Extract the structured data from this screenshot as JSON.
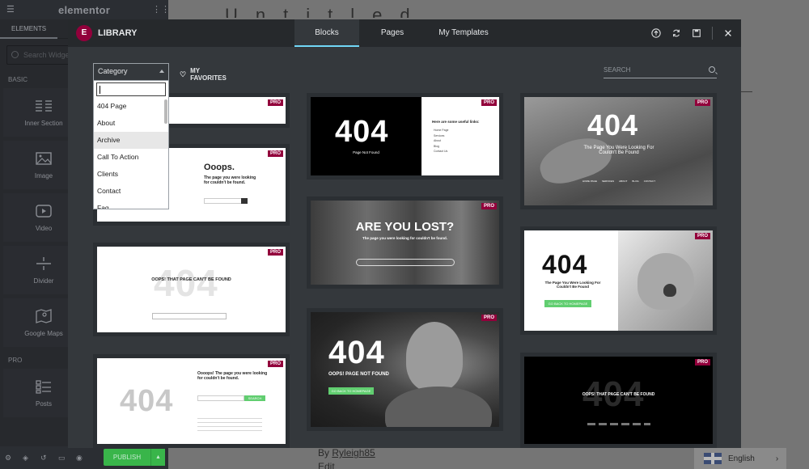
{
  "sidebar": {
    "brand": "elementor",
    "tab": "ELEMENTS",
    "search_placeholder": "Search Widget",
    "category_basic": "BASIC",
    "category_pro": "PRO",
    "widgets": [
      "Inner Section",
      "Image",
      "Video",
      "Divider",
      "Google Maps",
      "Posts"
    ],
    "publish_label": "PUBLISH"
  },
  "preview": {
    "title_stub": "Untitled",
    "by_label": "By",
    "author": "Ryleigh85",
    "edit_label": "Edit",
    "language": "English"
  },
  "modal": {
    "title": "LIBRARY",
    "tabs": [
      "Blocks",
      "Pages",
      "My Templates"
    ],
    "active_tab": "Blocks",
    "category_label": "Category",
    "category_options": [
      "404 Page",
      "About",
      "Archive",
      "Call To Action",
      "Clients",
      "Contact",
      "Faq"
    ],
    "highlighted_option": "Archive",
    "favorites_label": "MY FAVORITES",
    "search_placeholder": "SEARCH",
    "pro_badge": "PRO",
    "accent_color": "#92003b",
    "tab_underline_color": "#71d7f7"
  },
  "templates": {
    "c2": {
      "heading": "Ooops.",
      "sub": "The page you were looking for couldn't be found."
    },
    "c3": {
      "text": "OOPS! THAT PAGE CAN'T BE FOUND"
    },
    "c4": {
      "number": "404",
      "heading": "Oooops! The page you were looking for couldn't be found.",
      "button": "SEARCH"
    },
    "m1": {
      "number": "404",
      "sub": "Page Not Found",
      "links_title": "Here are some useful links:",
      "links": [
        "Home Page",
        "Services",
        "About",
        "Blog",
        "Contact Us"
      ]
    },
    "m2": {
      "heading": "ARE YOU LOST?",
      "sub": "The page you were looking for couldn't be found."
    },
    "m3": {
      "number": "404",
      "sub": "OOPS! PAGE NOT FOUND",
      "button": "GO BACK TO HOMEPAGE"
    },
    "r1": {
      "number": "404",
      "sub": "The Page You Were Looking For Couldn't Be Found",
      "links": [
        "HOME PAGE",
        "SERVICES",
        "ABOUT",
        "BLOG",
        "CONTACT"
      ]
    },
    "r2": {
      "number": "404",
      "sub": "The Page You Were Looking For Couldn't Be Found",
      "button": "GO BACK TO HOMEPAGE"
    },
    "r3": {
      "number": "404",
      "sub": "OOPS! THAT PAGE CAN'T BE FOUND"
    }
  }
}
